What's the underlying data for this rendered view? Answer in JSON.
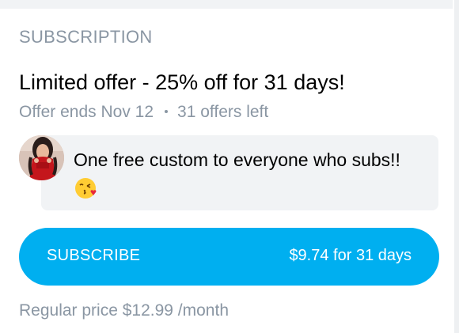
{
  "section": {
    "title": "SUBSCRIPTION"
  },
  "offer": {
    "title": "Limited offer - 25% off for 31 days!",
    "ends": "Offer ends Nov 12",
    "left": "31 offers left"
  },
  "message": {
    "text": "One free custom to everyone who subs!!",
    "emoji_icon": "face-blowing-kiss-icon",
    "avatar_icon": "profile-avatar"
  },
  "subscribe_button": {
    "label": "SUBSCRIBE",
    "price": "$9.74 for 31 days"
  },
  "regular_price": {
    "text": "Regular price $12.99 /month"
  },
  "colors": {
    "accent": "#00aff0",
    "muted_text": "#8a96a3",
    "bubble_bg": "#f1f3f5"
  }
}
